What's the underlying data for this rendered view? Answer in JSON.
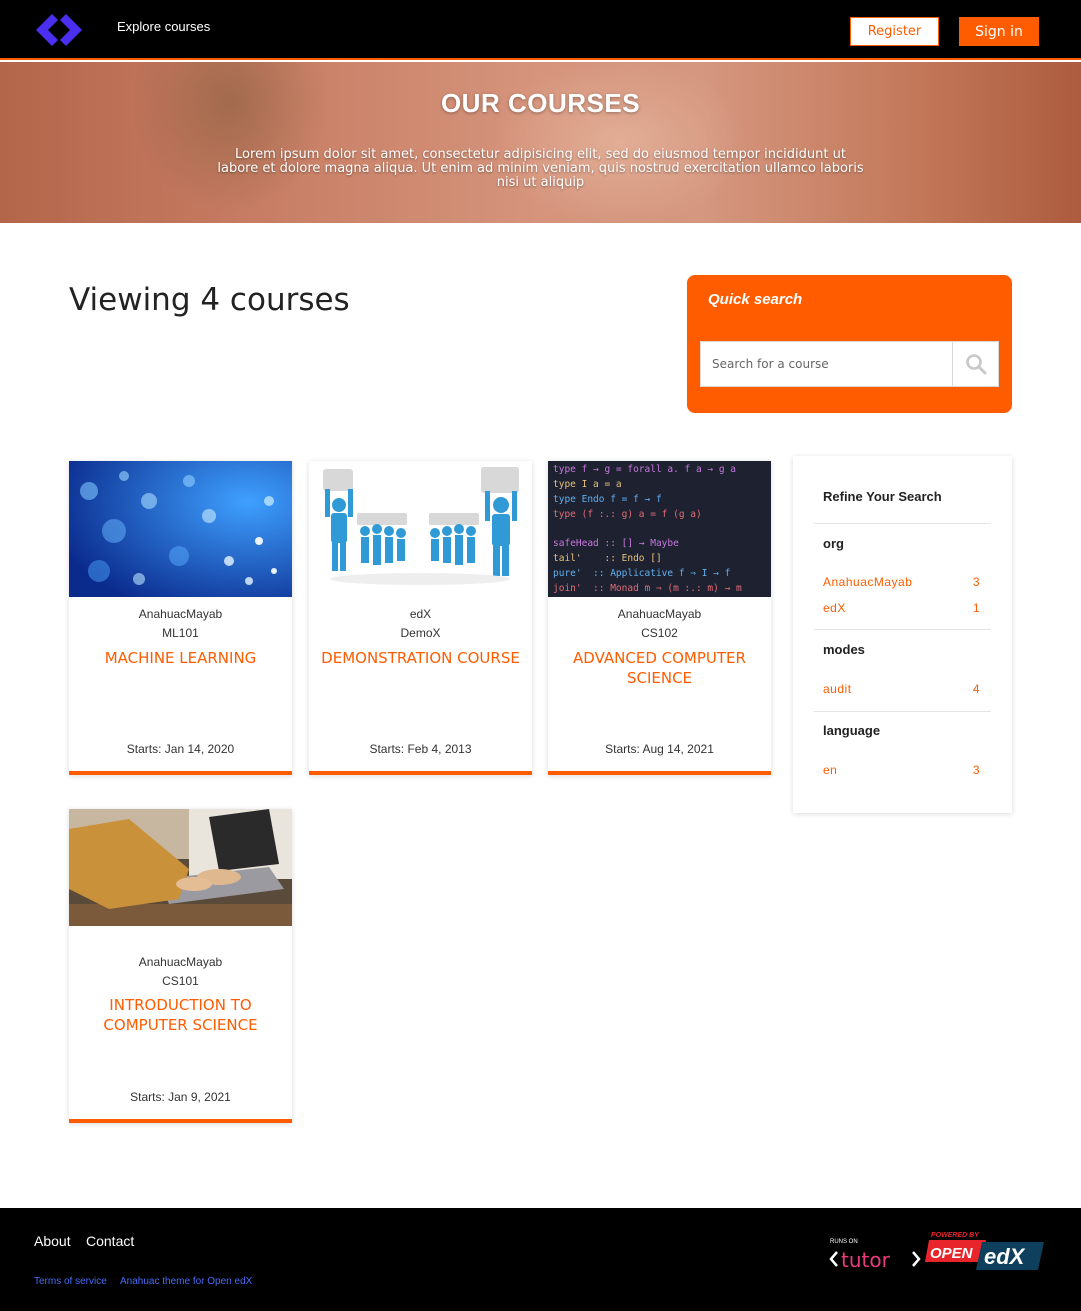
{
  "header": {
    "nav_explore": "Explore courses",
    "register_label": "Register",
    "signin_label": "Sign in"
  },
  "hero": {
    "title": "OUR COURSES",
    "text": "Lorem ipsum dolor sit amet, consectetur adipisicing elit, sed do eiusmod tempor incididunt ut labore et dolore magna aliqua. Ut enim ad minim veniam, quis nostrud exercitation ullamco laboris nisi ut aliquip"
  },
  "main": {
    "viewing_text": "Viewing 4 courses"
  },
  "quick_search": {
    "title": "Quick search",
    "placeholder": "Search for a course"
  },
  "courses": [
    {
      "org": "AnahuacMayab",
      "code": "ML101",
      "title": "MACHINE LEARNING",
      "start": "Starts: Jan 14, 2020"
    },
    {
      "org": "edX",
      "code": "DemoX",
      "title": "DEMONSTRATION COURSE",
      "start": "Starts: Feb 4, 2013"
    },
    {
      "org": "AnahuacMayab",
      "code": "CS102",
      "title": "ADVANCED COMPUTER SCIENCE",
      "start": "Starts: Aug 14, 2021"
    },
    {
      "org": "AnahuacMayab",
      "code": "CS101",
      "title": "INTRODUCTION TO COMPUTER SCIENCE",
      "start": "Starts: Jan 9, 2021"
    }
  ],
  "code_image_lines": [
    "type f → g = forall a. f a → g a",
    "type I a = a",
    "type Endo f = f → f",
    "type (f :.: g) a = f (g a)",
    "",
    "safeHead :: [] → Maybe",
    "tail'    :: Endo []",
    "pure'  :: Applicative f ⇒ I → f",
    "join'  :: Monad m ⇒ (m :.: m) → m"
  ],
  "refine": {
    "title": "Refine Your Search",
    "facets": [
      {
        "name": "org",
        "items": [
          {
            "label": "AnahuacMayab",
            "count": "3"
          },
          {
            "label": "edX",
            "count": "1"
          }
        ]
      },
      {
        "name": "modes",
        "items": [
          {
            "label": "audit",
            "count": "4"
          }
        ]
      },
      {
        "name": "language",
        "items": [
          {
            "label": "en",
            "count": "3"
          }
        ]
      }
    ]
  },
  "footer": {
    "about": "About",
    "contact": "Contact",
    "terms": "Terms of service",
    "theme": "Anahuac theme for Open edX",
    "tutor_runs_on": "RUNS ON",
    "tutor_name": "tutor",
    "openedx_powered": "POWERED BY",
    "openedx_open": "OPEN",
    "openedx_edx": "edX"
  },
  "colors": {
    "accent": "#ff5c00",
    "header_bg": "#000000",
    "logo": "#4a2ff0",
    "footer_link_small": "#4a6cf7"
  }
}
